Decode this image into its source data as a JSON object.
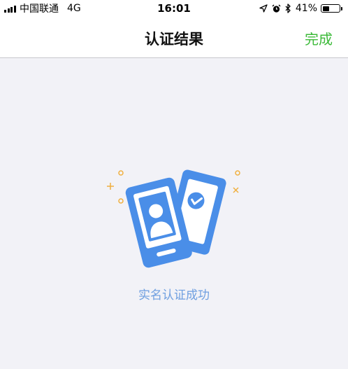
{
  "status_bar": {
    "carrier": "中国联通",
    "network": "4G",
    "time": "16:01",
    "battery_percent": "41%",
    "battery_level": 0.41,
    "icons": [
      "signal-icon",
      "location-arrow-icon",
      "alarm-icon",
      "bluetooth-icon",
      "battery-icon"
    ]
  },
  "nav": {
    "title": "认证结果",
    "done_label": "完成"
  },
  "result": {
    "message": "实名认证成功",
    "illustration_icon": "id-verified-icon"
  },
  "colors": {
    "accent_green": "#3dba3a",
    "illustration_blue": "#4a8ee8",
    "sparkle_orange": "#f0b040",
    "message_blue": "#6f9fe0",
    "background": "#f2f2f7"
  }
}
